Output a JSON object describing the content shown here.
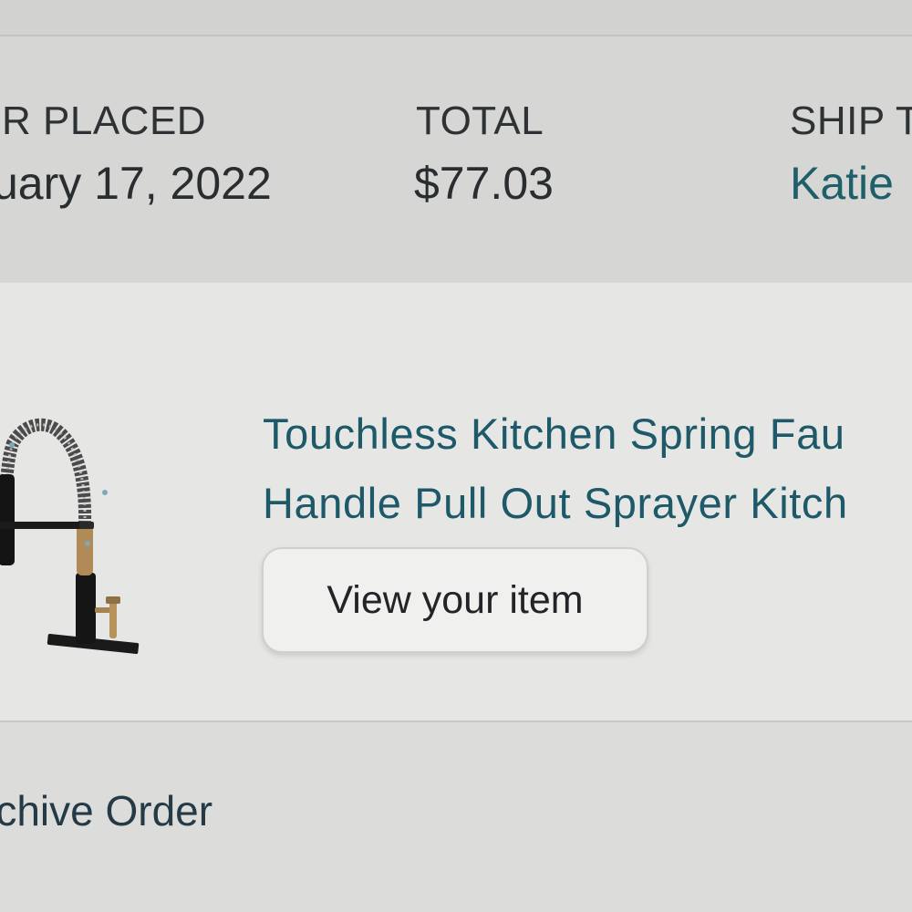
{
  "order_header": {
    "placed_label": "R PLACED",
    "placed_value": "uary 17, 2022",
    "total_label": "TOTAL",
    "total_value": "$77.03",
    "ship_label": "SHIP T",
    "ship_value": "Katie"
  },
  "item": {
    "title_line_1": "Touchless Kitchen Spring Fau",
    "title_line_2": "Handle Pull Out Sprayer Kitch",
    "view_button_label": "View your item",
    "image_icon": "kitchen-faucet-image"
  },
  "footer": {
    "archive_label": "rchive Order"
  },
  "colors": {
    "link": "#1d5968",
    "text": "#2a2d30",
    "background": "#e3e3e1"
  }
}
